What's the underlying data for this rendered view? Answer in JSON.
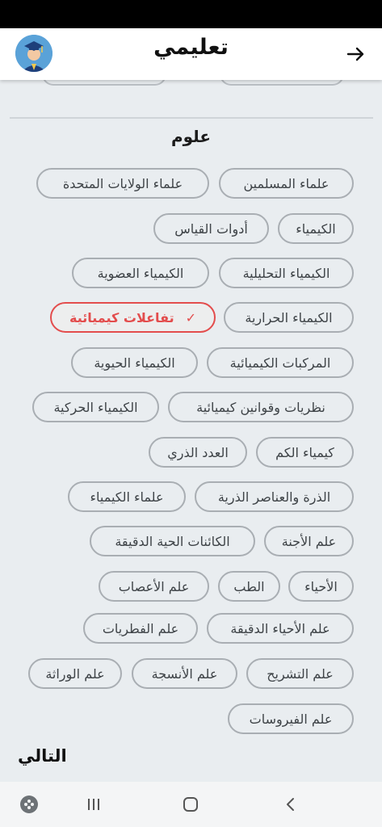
{
  "header": {
    "title": "تعليمي"
  },
  "section": {
    "title": "علوم"
  },
  "chips": [
    {
      "label": "علماء المسلمين",
      "selected": false
    },
    {
      "label": "علماء الولايات المتحدة",
      "selected": false
    },
    {
      "label": "الكيمياء",
      "selected": false
    },
    {
      "label": "أدوات القياس",
      "selected": false
    },
    {
      "label": "الكيمياء التحليلية",
      "selected": false
    },
    {
      "label": "الكيمياء العضوية",
      "selected": false
    },
    {
      "label": "الكيمياء الحرارية",
      "selected": false
    },
    {
      "label": "تفاعلات كيميائية",
      "selected": true
    },
    {
      "label": "المركبات الكيميائية",
      "selected": false
    },
    {
      "label": "الكيمياء الحيوية",
      "selected": false
    },
    {
      "label": "نظريات وقوانين كيميائية",
      "selected": false
    },
    {
      "label": "الكيمياء الحركية",
      "selected": false
    },
    {
      "label": "كيمياء الكم",
      "selected": false
    },
    {
      "label": "العدد الذري",
      "selected": false
    },
    {
      "label": "الذرة والعناصر الذرية",
      "selected": false
    },
    {
      "label": "علماء الكيمياء",
      "selected": false
    },
    {
      "label": "علم الأجنة",
      "selected": false
    },
    {
      "label": "الكائنات الحية الدقيقة",
      "selected": false
    },
    {
      "label": "الأحياء",
      "selected": false
    },
    {
      "label": "الطب",
      "selected": false
    },
    {
      "label": "علم الأعصاب",
      "selected": false
    },
    {
      "label": "علم الأحياء الدقيقة",
      "selected": false
    },
    {
      "label": "علم الفطريات",
      "selected": false
    },
    {
      "label": "علم التشريح",
      "selected": false
    },
    {
      "label": "علم الأنسجة",
      "selected": false
    },
    {
      "label": "علم الوراثة",
      "selected": false
    },
    {
      "label": "علم الفيروسات",
      "selected": false
    }
  ],
  "footer": {
    "next_label": "التالي"
  },
  "colors": {
    "selected_accent": "#e34d4d",
    "chip_border": "#a9aeb3",
    "background": "#e9edf0"
  }
}
